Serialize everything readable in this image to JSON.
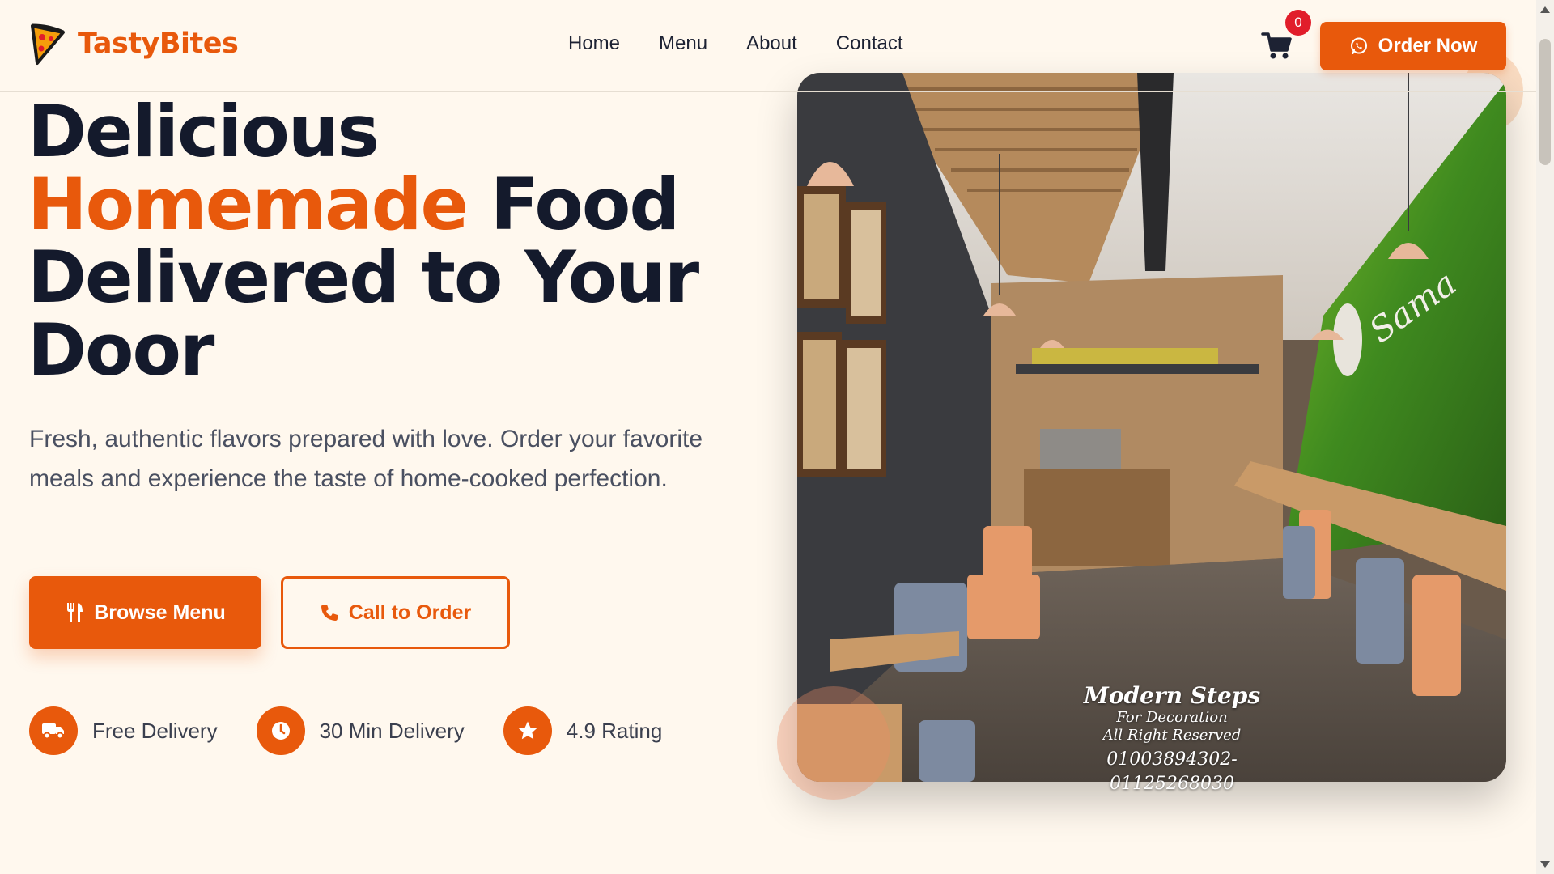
{
  "brand": {
    "name": "TastyBites",
    "icon": "pizza-slice-icon"
  },
  "nav": {
    "links": [
      {
        "label": "Home"
      },
      {
        "label": "Menu"
      },
      {
        "label": "About"
      },
      {
        "label": "Contact"
      }
    ],
    "cart_count": "0",
    "order_button": {
      "label": "Order Now",
      "icon": "whatsapp-icon"
    }
  },
  "hero": {
    "title_line1": "Delicious",
    "title_accent": "Homemade",
    "title_rest1": " Food",
    "title_line3": "Delivered to Your",
    "title_line4": "Door",
    "subtitle": "Fresh, authentic flavors prepared with love. Order your favorite meals and experience the taste of home-cooked perfection.",
    "primary_button": {
      "label": "Browse Menu",
      "icon": "utensils-icon"
    },
    "secondary_button": {
      "label": "Call to Order",
      "icon": "phone-icon"
    },
    "features": [
      {
        "label": "Free Delivery",
        "icon": "truck-icon"
      },
      {
        "label": "30 Min Delivery",
        "icon": "clock-icon"
      },
      {
        "label": "4.9 Rating",
        "icon": "star-icon"
      }
    ],
    "image_watermark": {
      "title": "Modern Steps",
      "line1": "For Decoration",
      "line2": "All Right Reserved",
      "phone": "01003894302-01125268030"
    }
  },
  "colors": {
    "accent": "#e8590c",
    "background": "#fff8ee",
    "heading": "#141a2c",
    "badge": "#e11d2a"
  }
}
